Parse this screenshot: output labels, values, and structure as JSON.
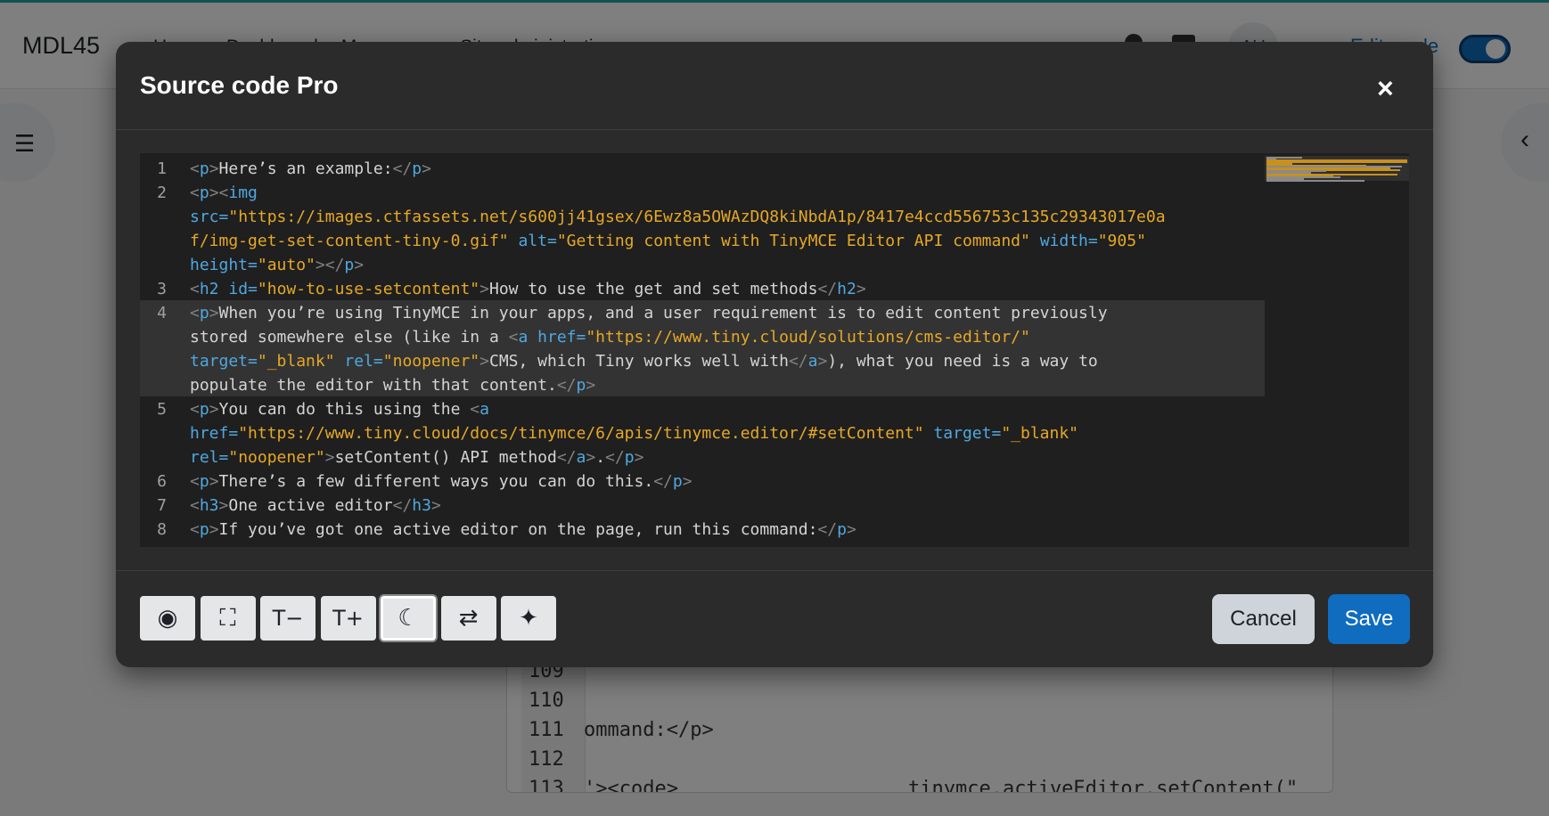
{
  "background": {
    "brand": "MDL45",
    "nav_links": [
      "Home",
      "Dashboard",
      "My courses",
      "Site administration"
    ],
    "avatar_initials": "AU",
    "edit_mode_label": "Edit mode",
    "editor_line_numbers": [
      "109",
      "110",
      "111",
      "112",
      "113"
    ],
    "editor_line_111": "ommand:</p>",
    "editor_line_113_a": "'><code>",
    "editor_line_113_b": "tinymce.activeEditor.setContent(\""
  },
  "modal": {
    "title": "Source code Pro",
    "close_glyph": "×",
    "code_lines": [
      {
        "num": "1",
        "segments": [
          [
            "br",
            "<"
          ],
          [
            "tag",
            "p"
          ],
          [
            "br",
            ">"
          ],
          [
            "txt",
            "Here’s an example:"
          ],
          [
            "br",
            "</"
          ],
          [
            "tag",
            "p"
          ],
          [
            "br",
            ">"
          ]
        ]
      },
      {
        "num": "2",
        "segments": [
          [
            "br",
            "<"
          ],
          [
            "tag",
            "p"
          ],
          [
            "br",
            "><"
          ],
          [
            "tag",
            "img"
          ]
        ]
      },
      {
        "num": "",
        "segments": [
          [
            "attr",
            "src="
          ],
          [
            "val",
            "\"https://images.ctfassets.net/s600jj41gsex/6Ewz8a5OWAzDQ8kiNbdA1p/8417e4ccd556753c135c29343017e0a"
          ]
        ]
      },
      {
        "num": "",
        "segments": [
          [
            "val",
            "f/img-get-set-content-tiny-0.gif\""
          ],
          [
            "txt",
            " "
          ],
          [
            "attr",
            "alt="
          ],
          [
            "val",
            "\"Getting content with TinyMCE Editor API command\""
          ],
          [
            "txt",
            " "
          ],
          [
            "attr",
            "width="
          ],
          [
            "val",
            "\"905\""
          ]
        ]
      },
      {
        "num": "",
        "segments": [
          [
            "attr",
            "height="
          ],
          [
            "val",
            "\"auto\""
          ],
          [
            "br",
            "></"
          ],
          [
            "tag",
            "p"
          ],
          [
            "br",
            ">"
          ]
        ]
      },
      {
        "num": "3",
        "segments": [
          [
            "br",
            "<"
          ],
          [
            "tag",
            "h2"
          ],
          [
            "txt",
            " "
          ],
          [
            "attr",
            "id="
          ],
          [
            "val",
            "\"how-to-use-setcontent\""
          ],
          [
            "br",
            ">"
          ],
          [
            "txt",
            "How to use the get and set methods"
          ],
          [
            "br",
            "</"
          ],
          [
            "tag",
            "h2"
          ],
          [
            "br",
            ">"
          ]
        ]
      },
      {
        "num": "4",
        "segments": [
          [
            "br",
            "<"
          ],
          [
            "tag",
            "p"
          ],
          [
            "br",
            ">"
          ],
          [
            "txt",
            "When you’re using TinyMCE in your apps, and a user requirement is to edit content previously"
          ]
        ]
      },
      {
        "num": "",
        "segments": [
          [
            "txt",
            "stored somewhere else (like in a "
          ],
          [
            "br",
            "<"
          ],
          [
            "tag",
            "a"
          ],
          [
            "txt",
            " "
          ],
          [
            "attr",
            "href="
          ],
          [
            "val",
            "\"https://www.tiny.cloud/solutions/cms-editor/\""
          ]
        ]
      },
      {
        "num": "",
        "segments": [
          [
            "attr",
            "target="
          ],
          [
            "val",
            "\"_blank\""
          ],
          [
            "txt",
            " "
          ],
          [
            "attr",
            "rel="
          ],
          [
            "val",
            "\"noopener\""
          ],
          [
            "br",
            ">"
          ],
          [
            "txt",
            "CMS, which Tiny works well with"
          ],
          [
            "br",
            "</"
          ],
          [
            "tag",
            "a"
          ],
          [
            "br",
            ">"
          ],
          [
            "txt",
            "), what you need is a way to"
          ]
        ]
      },
      {
        "num": "",
        "segments": [
          [
            "txt",
            "populate the editor with that content."
          ],
          [
            "br",
            "</"
          ],
          [
            "tag",
            "p"
          ],
          [
            "br",
            ">"
          ]
        ]
      },
      {
        "num": "5",
        "segments": [
          [
            "br",
            "<"
          ],
          [
            "tag",
            "p"
          ],
          [
            "br",
            ">"
          ],
          [
            "txt",
            "You can do this using the "
          ],
          [
            "br",
            "<"
          ],
          [
            "tag",
            "a"
          ]
        ]
      },
      {
        "num": "",
        "segments": [
          [
            "attr",
            "href="
          ],
          [
            "val",
            "\"https://www.tiny.cloud/docs/tinymce/6/apis/tinymce.editor/#setContent\""
          ],
          [
            "txt",
            " "
          ],
          [
            "attr",
            "target="
          ],
          [
            "val",
            "\"_blank\""
          ]
        ]
      },
      {
        "num": "",
        "segments": [
          [
            "attr",
            "rel="
          ],
          [
            "val",
            "\"noopener\""
          ],
          [
            "br",
            ">"
          ],
          [
            "txt",
            "setContent() API method"
          ],
          [
            "br",
            "</"
          ],
          [
            "tag",
            "a"
          ],
          [
            "br",
            ">"
          ],
          [
            "txt",
            "."
          ],
          [
            "br",
            "</"
          ],
          [
            "tag",
            "p"
          ],
          [
            "br",
            ">"
          ]
        ]
      },
      {
        "num": "6",
        "segments": [
          [
            "br",
            "<"
          ],
          [
            "tag",
            "p"
          ],
          [
            "br",
            ">"
          ],
          [
            "txt",
            "There’s a few different ways you can do this."
          ],
          [
            "br",
            "</"
          ],
          [
            "tag",
            "p"
          ],
          [
            "br",
            ">"
          ]
        ]
      },
      {
        "num": "7",
        "segments": [
          [
            "br",
            "<"
          ],
          [
            "tag",
            "h3"
          ],
          [
            "br",
            ">"
          ],
          [
            "txt",
            "One active editor"
          ],
          [
            "br",
            "</"
          ],
          [
            "tag",
            "h3"
          ],
          [
            "br",
            ">"
          ]
        ]
      },
      {
        "num": "8",
        "segments": [
          [
            "br",
            "<"
          ],
          [
            "tag",
            "p"
          ],
          [
            "br",
            ">"
          ],
          [
            "txt",
            "If you’ve got one active editor on the page, run this command:"
          ],
          [
            "br",
            "</"
          ],
          [
            "tag",
            "p"
          ],
          [
            "br",
            ">"
          ]
        ]
      }
    ],
    "toolbar": [
      {
        "name": "preview-button",
        "icon": "eye-icon",
        "glyph": "◉"
      },
      {
        "name": "fullscreen-button",
        "icon": "expand-icon",
        "glyph": "⛶"
      },
      {
        "name": "decrease-font-button",
        "icon": "text-decrease-icon",
        "glyph": "T−"
      },
      {
        "name": "increase-font-button",
        "icon": "text-increase-icon",
        "glyph": "T+"
      },
      {
        "name": "dark-mode-button",
        "icon": "moon-icon",
        "glyph": "☾",
        "active": true
      },
      {
        "name": "swap-button",
        "icon": "swap-arrows-icon",
        "glyph": "⇄"
      },
      {
        "name": "format-button",
        "icon": "magic-wand-icon",
        "glyph": "✦"
      }
    ],
    "cancel_label": "Cancel",
    "save_label": "Save"
  },
  "colors": {
    "modal_bg": "#2b2b2b",
    "code_bg": "#1f1f1f",
    "tag": "#4fa8e0",
    "value": "#e6a826",
    "save": "#0f6cbf"
  }
}
